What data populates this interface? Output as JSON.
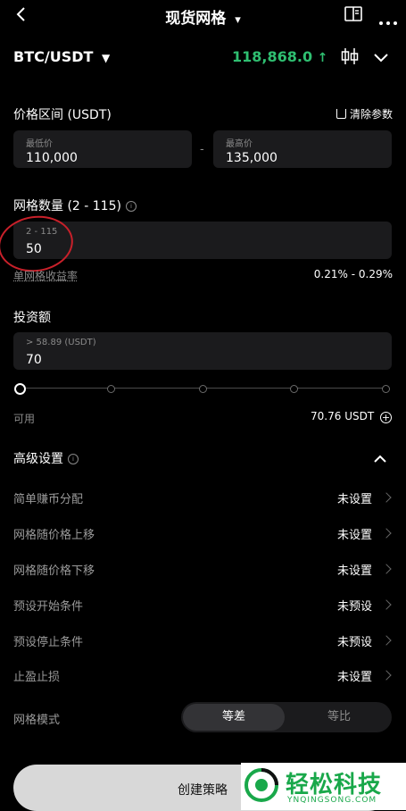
{
  "header": {
    "title": "现货网格",
    "title_caret": "▾"
  },
  "pair": {
    "symbol": "BTC/USDT",
    "price": "118,868.0",
    "price_color": "#2fbf71"
  },
  "price_range": {
    "label": "价格区间 (USDT)",
    "clear_label": "清除参数",
    "low_hint": "最低价",
    "low_value": "110,000",
    "separator": "-",
    "high_hint": "最高价",
    "high_value": "135,000"
  },
  "grid_count": {
    "label": "网格数量 (2 - 115)",
    "hint": "2 - 115",
    "value": "50",
    "yield_label": "单网格收益率",
    "yield_value": "0.21% - 0.29%"
  },
  "investment": {
    "label": "投资额",
    "hint": "> 58.89 (USDT)",
    "value": "70",
    "available_label": "可用",
    "available_value": "70.76 USDT"
  },
  "advanced": {
    "label": "高级设置",
    "rows": [
      {
        "label": "简单赚币分配",
        "value": "未设置"
      },
      {
        "label": "网格随价格上移",
        "value": "未设置"
      },
      {
        "label": "网格随价格下移",
        "value": "未设置"
      },
      {
        "label": "预设开始条件",
        "value": "未预设"
      },
      {
        "label": "预设停止条件",
        "value": "未预设"
      },
      {
        "label": "止盈止损",
        "value": "未设置"
      }
    ],
    "mode_label": "网格模式",
    "mode_options": [
      "等差",
      "等比"
    ],
    "mode_selected": "等差"
  },
  "create_button": "创建策略",
  "watermark": {
    "name": "轻松科技",
    "url": "YNQINGSONG.COM"
  }
}
